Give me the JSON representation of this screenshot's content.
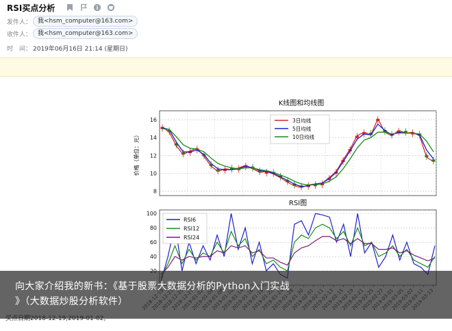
{
  "mail": {
    "subject": "RSI买点分析",
    "icons": [
      "bookmark-icon",
      "flag-icon",
      "info-icon",
      "print-icon"
    ],
    "from_label": "发件人：",
    "from_value": "我<hsm_computer@163.com>",
    "to_label": "收件人：",
    "to_value": "我<hsm_computer@163.com>",
    "time_label": "时　间：",
    "time_value": "2019年06月16日 21:14 (星期日)"
  },
  "colors": {
    "ma3": "#d62728",
    "ma5": "#1f1fcf",
    "ma10": "#1a8a1a",
    "rsi6": "#1f1fcf",
    "rsi12": "#1a8a1a",
    "rsi24": "#7a1a7a",
    "candle_up": "#d62728",
    "candle_down": "#1a8a1a"
  },
  "chart_data": [
    {
      "type": "line",
      "title": "K线图和均线图",
      "ylabel": "价格（单位：元）",
      "ylim": [
        7.5,
        17.0
      ],
      "yticks": [
        8,
        10,
        12,
        14,
        16
      ],
      "legend_position": "top-center",
      "grid": true,
      "series": [
        {
          "name": "3日均线",
          "values": [
            15.2,
            14.6,
            13.1,
            12.1,
            12.5,
            12.8,
            11.9,
            10.8,
            10.2,
            10.5,
            10.4,
            10.6,
            10.9,
            10.5,
            10.1,
            10.2,
            9.9,
            9.5,
            9.0,
            8.6,
            8.4,
            8.7,
            8.8,
            8.9,
            9.5,
            10.2,
            11.5,
            12.7,
            14.2,
            14.6,
            14.3,
            16.1,
            14.6,
            14.2,
            14.8,
            14.5,
            14.6,
            14.2,
            11.8,
            11.3
          ]
        },
        {
          "name": "5日均线",
          "values": [
            15.1,
            14.9,
            13.5,
            12.4,
            12.4,
            12.6,
            12.1,
            11.1,
            10.5,
            10.4,
            10.4,
            10.5,
            10.8,
            10.6,
            10.3,
            10.2,
            10.0,
            9.6,
            9.2,
            8.8,
            8.5,
            8.6,
            8.8,
            8.9,
            9.4,
            10.1,
            11.3,
            12.5,
            13.8,
            14.4,
            14.3,
            15.5,
            14.8,
            14.3,
            14.6,
            14.5,
            14.5,
            14.3,
            12.6,
            11.6
          ]
        },
        {
          "name": "10日均线",
          "values": [
            15.0,
            14.9,
            14.1,
            13.2,
            12.8,
            12.7,
            12.4,
            11.7,
            11.1,
            10.8,
            10.6,
            10.5,
            10.6,
            10.6,
            10.4,
            10.3,
            10.1,
            9.8,
            9.5,
            9.1,
            8.8,
            8.7,
            8.7,
            8.8,
            9.1,
            9.6,
            10.5,
            11.6,
            12.8,
            13.7,
            14.0,
            14.6,
            14.6,
            14.4,
            14.5,
            14.5,
            14.5,
            14.4,
            13.6,
            12.4
          ]
        }
      ]
    },
    {
      "type": "line",
      "title": "RSI图",
      "ylim": [
        0,
        105
      ],
      "yticks": [
        0,
        20,
        40,
        60,
        80,
        100
      ],
      "legend_position": "top-left",
      "grid": true,
      "categories": [
        "2018-12-19",
        "2018-12-21",
        "2018-12-25",
        "2018-12-27",
        "2019-01-02",
        "2019-01-04",
        "2019-01-08",
        "2019-01-10",
        "2019-01-14",
        "2019-01-16",
        "2019-01-18",
        "2019-01-22",
        "2019-01-24",
        "2019-01-28",
        "2019-01-30",
        "2019-02-01",
        "2019-02-11",
        "2019-02-13",
        "2019-02-15",
        "2019-02-19",
        "2019-02-21",
        "2019-02-25",
        "2019-02-27",
        "2019-03-01",
        "2019-03-05",
        "2019-03-07",
        "2019-03-11",
        "2019-03-13"
      ],
      "series": [
        {
          "name": "RSI6",
          "values": [
            5,
            40,
            85,
            20,
            60,
            30,
            55,
            35,
            70,
            40,
            100,
            50,
            80,
            30,
            60,
            20,
            30,
            15,
            10,
            85,
            90,
            70,
            100,
            98,
            95,
            60,
            85,
            40,
            100,
            45,
            60,
            25,
            40,
            70,
            35,
            60,
            30,
            25,
            15,
            55
          ]
        },
        {
          "name": "RSI12",
          "values": [
            10,
            30,
            55,
            30,
            50,
            35,
            45,
            40,
            60,
            45,
            75,
            55,
            65,
            40,
            50,
            30,
            35,
            25,
            20,
            60,
            70,
            65,
            80,
            85,
            80,
            65,
            75,
            55,
            80,
            55,
            60,
            40,
            45,
            55,
            40,
            50,
            35,
            30,
            25,
            40
          ]
        },
        {
          "name": "RSI24",
          "values": [
            15,
            25,
            40,
            35,
            40,
            38,
            40,
            40,
            48,
            45,
            55,
            52,
            55,
            45,
            48,
            38,
            38,
            32,
            28,
            45,
            52,
            55,
            62,
            68,
            68,
            62,
            65,
            58,
            65,
            58,
            58,
            50,
            50,
            52,
            45,
            48,
            42,
            38,
            34,
            38
          ]
        }
      ]
    }
  ],
  "caption": {
    "line1": "向大家介绍我的新书：《基于股票大数据分析的Python入门实战",
    "line2": "》（大数据炒股分析软件）"
  },
  "footer": {
    "note": "买点日期2018-12-19,2019-01-02,"
  }
}
